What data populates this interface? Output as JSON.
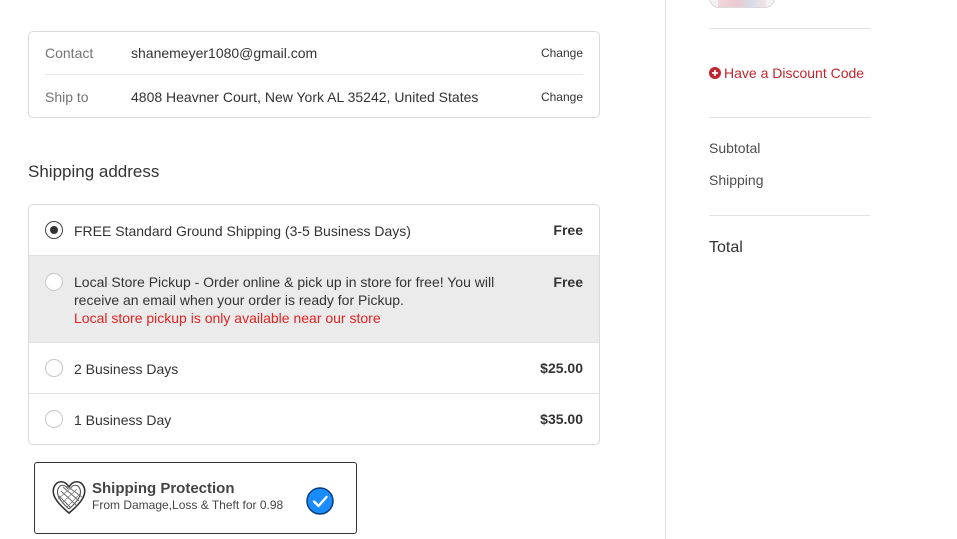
{
  "review": {
    "contact_label": "Contact",
    "contact_value": "shanemeyer1080@gmail.com",
    "contact_change": "Change",
    "shipto_label": "Ship to",
    "shipto_value": "4808 Heavner Court, New York AL 35242, United States",
    "shipto_change": "Change"
  },
  "shipping": {
    "title": "Shipping address",
    "options": [
      {
        "label": "FREE Standard Ground Shipping (3-5 Business Days)",
        "price": "Free",
        "selected": true
      },
      {
        "label": "Local Store Pickup - Order online & pick up in store for free! You will receive an email when your order is ready for Pickup.",
        "note": "Local store pickup is only available near our store",
        "price": "Free",
        "selected": false
      },
      {
        "label": "2 Business Days",
        "price": "$25.00",
        "selected": false
      },
      {
        "label": "1 Business Day",
        "price": "$35.00",
        "selected": false
      }
    ]
  },
  "protection": {
    "title": "Shipping Protection",
    "subtitle": "From Damage,Loss & Theft for 0.98",
    "checked": true,
    "check_color": "#1a8cff"
  },
  "sidebar": {
    "discount_label": "Have a Discount Code",
    "subtotal_label": "Subtotal",
    "shipping_label": "Shipping",
    "total_label": "Total"
  },
  "colors": {
    "accent_red": "#c0262f",
    "note_red": "#e32222",
    "selected_bg": "#ebebeb"
  }
}
